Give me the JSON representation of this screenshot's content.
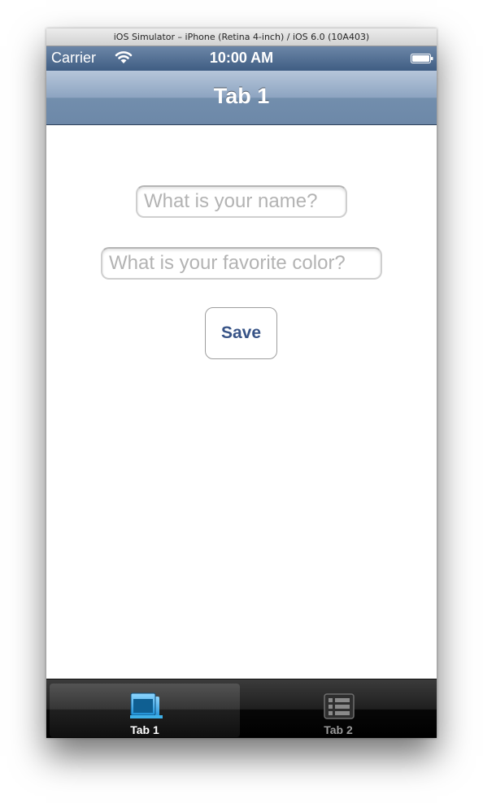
{
  "window": {
    "title": "iOS Simulator – iPhone (Retina 4-inch) / iOS 6.0 (10A403)"
  },
  "status_bar": {
    "carrier": "Carrier",
    "time": "10:00 AM",
    "wifi_icon": "wifi-icon",
    "battery_icon": "battery-icon"
  },
  "nav_bar": {
    "title": "Tab 1"
  },
  "form": {
    "name_placeholder": "What is your name?",
    "name_value": "",
    "color_placeholder": "What is your favorite color?",
    "color_value": "",
    "save_label": "Save"
  },
  "tab_bar": {
    "tabs": [
      {
        "label": "Tab 1",
        "icon": "windows-icon",
        "selected": true
      },
      {
        "label": "Tab 2",
        "icon": "list-icon",
        "selected": false
      }
    ]
  },
  "colors": {
    "accent_text": "#385487",
    "nav_bar": "#6d88a8",
    "tab_bar": "#000000",
    "selected_tab_icon": "#3fb0e8"
  }
}
